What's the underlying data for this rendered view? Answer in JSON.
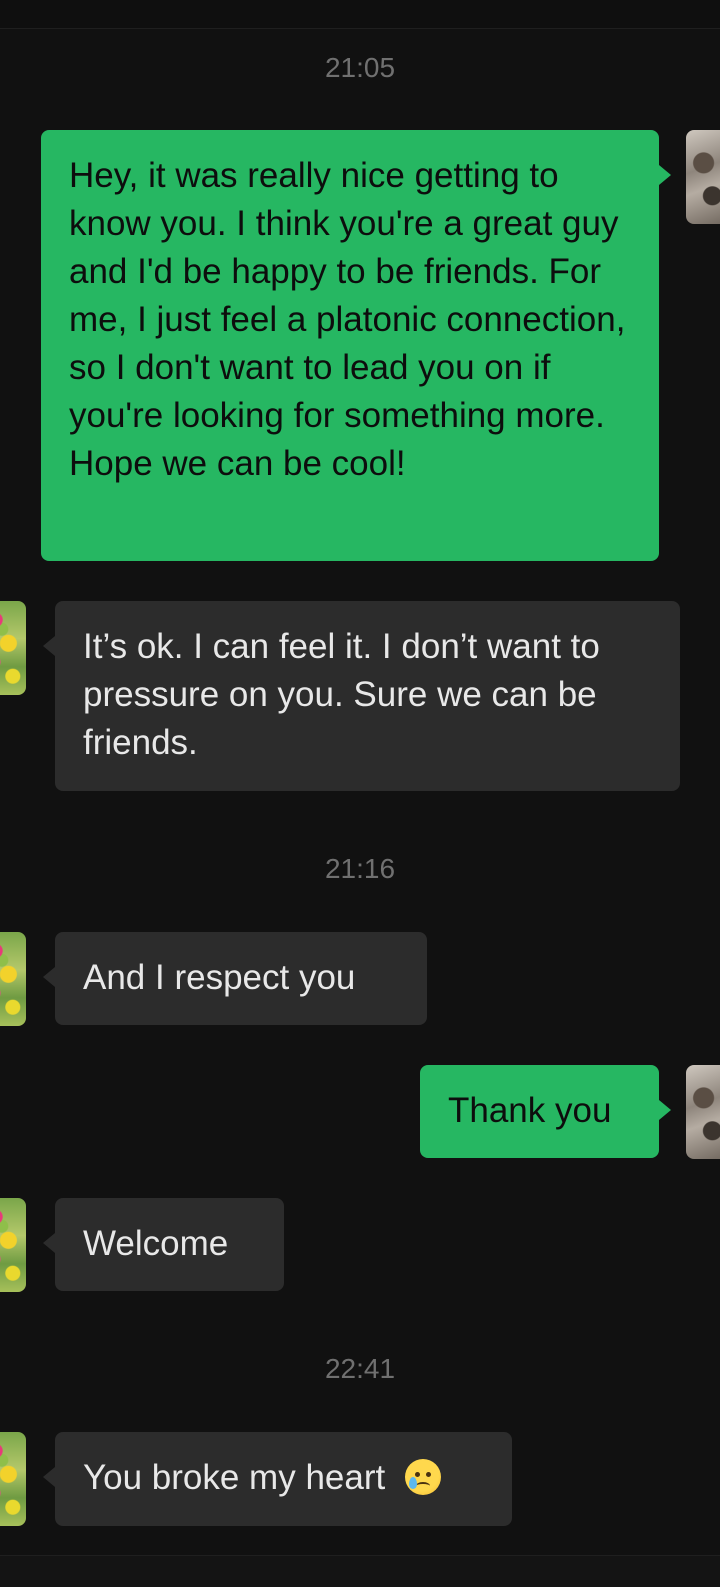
{
  "conversation": {
    "messages": [
      {
        "type": "timestamp",
        "text": "21:05"
      },
      {
        "type": "outgoing",
        "text": "Hey, it was really nice getting to know you. I think you're a great guy and I'd be happy to be friends. For me, I just feel a platonic connection, so I don't want to lead you on if you're looking for something more. Hope we can be cool!"
      },
      {
        "type": "incoming",
        "text": "It’s ok. I can feel it. I don’t want to pressure on you. Sure we can be friends."
      },
      {
        "type": "timestamp",
        "text": "21:16"
      },
      {
        "type": "incoming",
        "text": "And I respect you"
      },
      {
        "type": "outgoing",
        "text": "Thank you"
      },
      {
        "type": "incoming",
        "text": "Welcome"
      },
      {
        "type": "timestamp",
        "text": "22:41"
      },
      {
        "type": "incoming",
        "text": "You broke my heart",
        "emoji": "crying-face-icon"
      }
    ]
  },
  "colors": {
    "background": "#111111",
    "outgoing_bubble": "#26b762",
    "incoming_bubble": "#2c2c2c",
    "timestamp_text": "#707070"
  }
}
